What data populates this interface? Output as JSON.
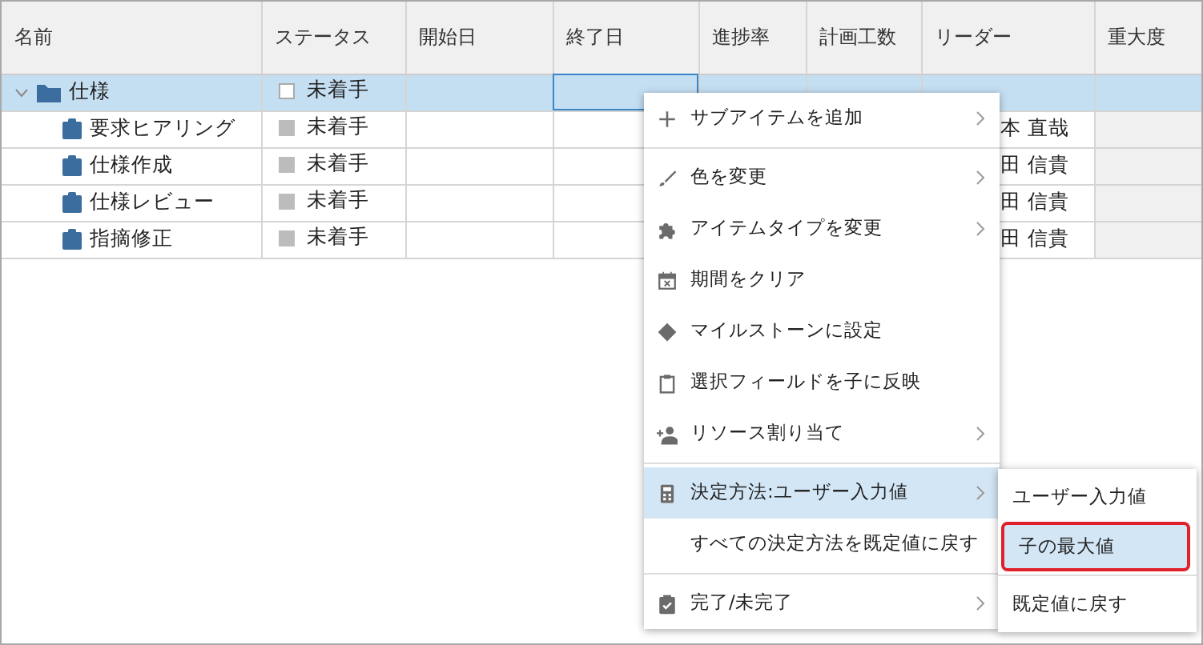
{
  "table": {
    "columns": [
      "名前",
      "ステータス",
      "開始日",
      "終了日",
      "進捗率",
      "計画工数",
      "リーダー",
      "重大度"
    ],
    "rows": [
      {
        "name": "仕様",
        "kind": "folder",
        "expanded": true,
        "selected": true,
        "end_cell_focused": true,
        "status": "未着手",
        "children": [
          {
            "name": "要求ヒアリング",
            "kind": "task",
            "selected": false,
            "end_cell_focused": false,
            "status": "未着手",
            "leader": "本 直哉"
          },
          {
            "name": "仕様作成",
            "kind": "task",
            "selected": false,
            "end_cell_focused": false,
            "status": "未着手",
            "leader": "田 信貴"
          },
          {
            "name": "仕様レビュー",
            "kind": "task",
            "selected": false,
            "end_cell_focused": false,
            "status": "未着手",
            "leader": "田 信貴"
          },
          {
            "name": "指摘修正",
            "kind": "task",
            "selected": false,
            "end_cell_focused": false,
            "status": "未着手",
            "leader": "田 信貴"
          }
        ]
      }
    ]
  },
  "context_menu": {
    "items": [
      {
        "kind": "item",
        "label": "サブアイテムを追加",
        "submenu": true,
        "selected": false
      },
      {
        "kind": "divider"
      },
      {
        "kind": "item",
        "label": "色を変更",
        "submenu": true,
        "selected": false
      },
      {
        "kind": "item",
        "label": "アイテムタイプを変更",
        "submenu": true,
        "selected": false
      },
      {
        "kind": "item",
        "label": "期間をクリア",
        "submenu": false,
        "selected": false
      },
      {
        "kind": "item",
        "label": "マイルストーンに設定",
        "submenu": false,
        "selected": false
      },
      {
        "kind": "item",
        "label": "選択フィールドを子に反映",
        "submenu": false,
        "selected": false
      },
      {
        "kind": "item",
        "label": "リソース割り当て",
        "submenu": true,
        "selected": false
      },
      {
        "kind": "divider"
      },
      {
        "kind": "item",
        "label": "決定方法:ユーザー入力値",
        "submenu": true,
        "selected": true
      },
      {
        "kind": "item",
        "label": "すべての決定方法を既定値に戻す",
        "submenu": false,
        "selected": false
      },
      {
        "kind": "divider"
      },
      {
        "kind": "item",
        "label": "完了/未完了",
        "submenu": true,
        "selected": false
      }
    ]
  },
  "submenu": {
    "items": [
      {
        "kind": "item",
        "label": "ユーザー入力値",
        "selected": false
      },
      {
        "kind": "item",
        "label": "子の最大値",
        "selected": true
      },
      {
        "kind": "divider"
      },
      {
        "kind": "item",
        "label": "既定値に戻す",
        "selected": false
      }
    ]
  }
}
